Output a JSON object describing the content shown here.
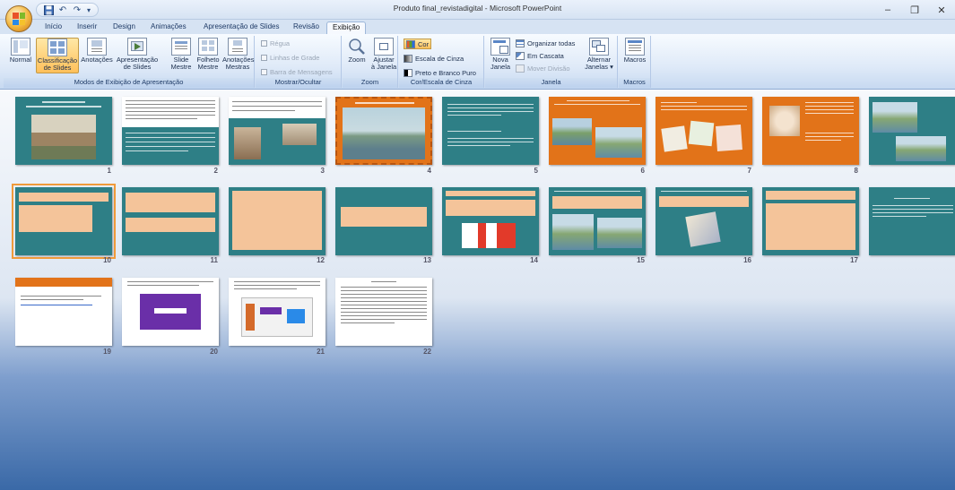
{
  "window": {
    "title": "Produto final_revistadigital - Microsoft PowerPoint",
    "minimize": "–",
    "restore": "❐",
    "close": "✕"
  },
  "quick_access": {
    "save_icon": "save-icon",
    "undo": "↶",
    "redo": "↷",
    "customize": "▾"
  },
  "tabs": [
    {
      "label": "Início"
    },
    {
      "label": "Inserir"
    },
    {
      "label": "Design"
    },
    {
      "label": "Animações"
    },
    {
      "label": "Apresentação de Slides"
    },
    {
      "label": "Revisão"
    },
    {
      "label": "Exibição"
    }
  ],
  "ribbon": {
    "groups": [
      {
        "label": "Modos de Exibição de Apresentação"
      },
      {
        "label": "Mostrar/Ocultar"
      },
      {
        "label": "Zoom"
      },
      {
        "label": "Cor/Escala de Cinza"
      },
      {
        "label": "Janela"
      },
      {
        "label": "Macros"
      }
    ],
    "views": [
      {
        "label1": "Normal",
        "label2": ""
      },
      {
        "label1": "Classificação",
        "label2": "de Slides"
      },
      {
        "label1": "Anotações",
        "label2": ""
      },
      {
        "label1": "Apresentação",
        "label2": "de Slides"
      },
      {
        "label1": "Slide",
        "label2": "Mestre"
      },
      {
        "label1": "Folheto",
        "label2": "Mestre"
      },
      {
        "label1": "Anotações",
        "label2": "Mestras"
      }
    ],
    "show_hide": {
      "ruler": "Régua",
      "gridlines": "Linhas de Grade",
      "message_bar": "Barra de Mensagens"
    },
    "zoom": {
      "zoom": "Zoom",
      "fit1": "Ajustar",
      "fit2": "à Janela"
    },
    "color": {
      "color": "Cor",
      "grayscale": "Escala de Cinza",
      "bw": "Preto e Branco Puro"
    },
    "window": {
      "new1": "Nova",
      "new2": "Janela",
      "arrange": "Organizar todas",
      "cascade": "Em Cascata",
      "move_split": "Mover Divisão",
      "switch1": "Alternar",
      "switch2": "Janelas ▾"
    },
    "macros": {
      "label": "Macros"
    }
  },
  "slides": [
    {
      "n": "1"
    },
    {
      "n": "2"
    },
    {
      "n": "3"
    },
    {
      "n": "4"
    },
    {
      "n": "5"
    },
    {
      "n": "6"
    },
    {
      "n": "7"
    },
    {
      "n": "8"
    },
    {
      "n": "10"
    },
    {
      "n": "11"
    },
    {
      "n": "12"
    },
    {
      "n": "13"
    },
    {
      "n": "14"
    },
    {
      "n": "15"
    },
    {
      "n": "16"
    },
    {
      "n": "17"
    },
    {
      "n": "19"
    },
    {
      "n": "20"
    },
    {
      "n": "21"
    },
    {
      "n": "22"
    }
  ],
  "colors": {
    "teal": "#2e7f86",
    "orange": "#e27319",
    "peach": "#f4c49a",
    "selection": "#f09a3a"
  }
}
